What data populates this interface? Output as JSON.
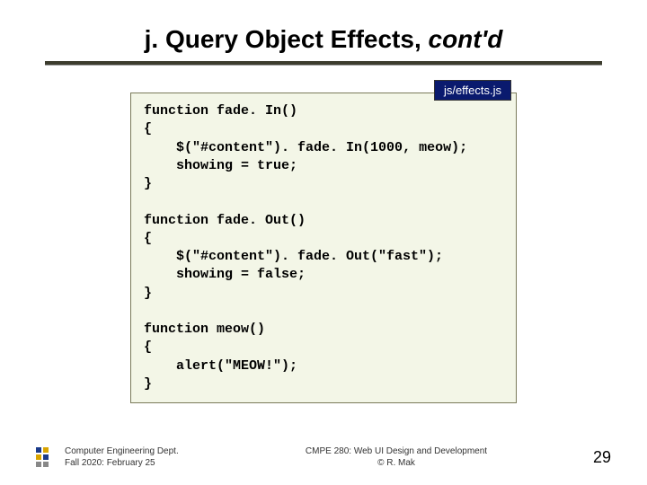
{
  "title": {
    "main": "j. Query Object Effects, ",
    "ital": "cont'd"
  },
  "file_label": "js/effects.js",
  "code": {
    "fn1_sig": "function fade. In()",
    "open": "{",
    "fn1_l1a": "    $(\"#content\"). fade. In(",
    "fn1_l1_num": "1000",
    "fn1_l1_sep": ", ",
    "fn1_l1_cb": "meow",
    "fn1_l1_end": ");",
    "fn1_l2": "    showing = true;",
    "close": "}",
    "blank": " ",
    "fn2_sig": "function fade. Out()",
    "fn2_l1": "    $(\"#content\"). fade. Out(\"fast\");",
    "fn2_l2": "    showing = false;",
    "fn3_sig": "function meow()",
    "fn3_l1": "    alert(\"MEOW!\");"
  },
  "footer": {
    "dept": "Computer Engineering Dept.",
    "term": "Fall 2020: February 25",
    "course": "CMPE 280: Web UI Design and Development",
    "author": "© R. Mak",
    "page": "29"
  }
}
